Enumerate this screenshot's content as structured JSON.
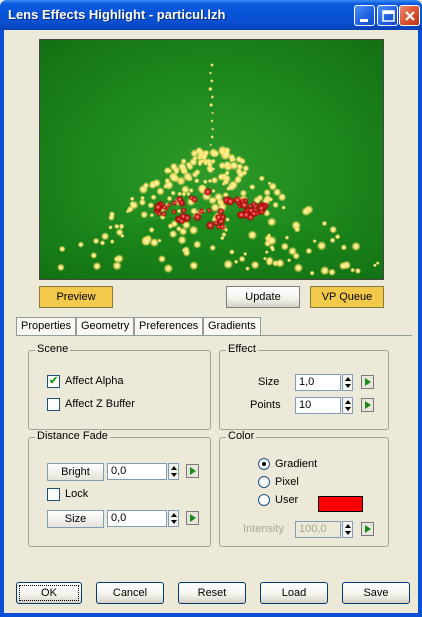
{
  "window": {
    "title": "Lens Effects Highlight - particul.lzh"
  },
  "preview_buttons": {
    "preview": "Preview",
    "update": "Update",
    "vp_queue": "VP Queue"
  },
  "tabs": [
    "Properties",
    "Geometry",
    "Preferences",
    "Gradients"
  ],
  "scene": {
    "label": "Scene",
    "affect_alpha": {
      "label": "Affect Alpha",
      "checked": true
    },
    "affect_z_buffer": {
      "label": "Affect Z Buffer",
      "checked": false
    }
  },
  "effect": {
    "label": "Effect",
    "size": {
      "label": "Size",
      "value": "1,0"
    },
    "points": {
      "label": "Points",
      "value": "10"
    }
  },
  "distance_fade": {
    "label": "Distance Fade",
    "bright": {
      "label": "Bright",
      "value": "0,0"
    },
    "lock": {
      "label": "Lock",
      "checked": false
    },
    "size": {
      "label": "Size",
      "value": "0,0"
    }
  },
  "color": {
    "label": "Color",
    "options": [
      "Gradient",
      "Pixel",
      "User"
    ],
    "selected": "Gradient",
    "user_color": "#ff0000",
    "intensity": {
      "label": "Intensity",
      "value": "100,0"
    }
  },
  "footer": {
    "ok": "OK",
    "cancel": "Cancel",
    "reset": "Reset",
    "load": "Load",
    "save": "Save"
  }
}
